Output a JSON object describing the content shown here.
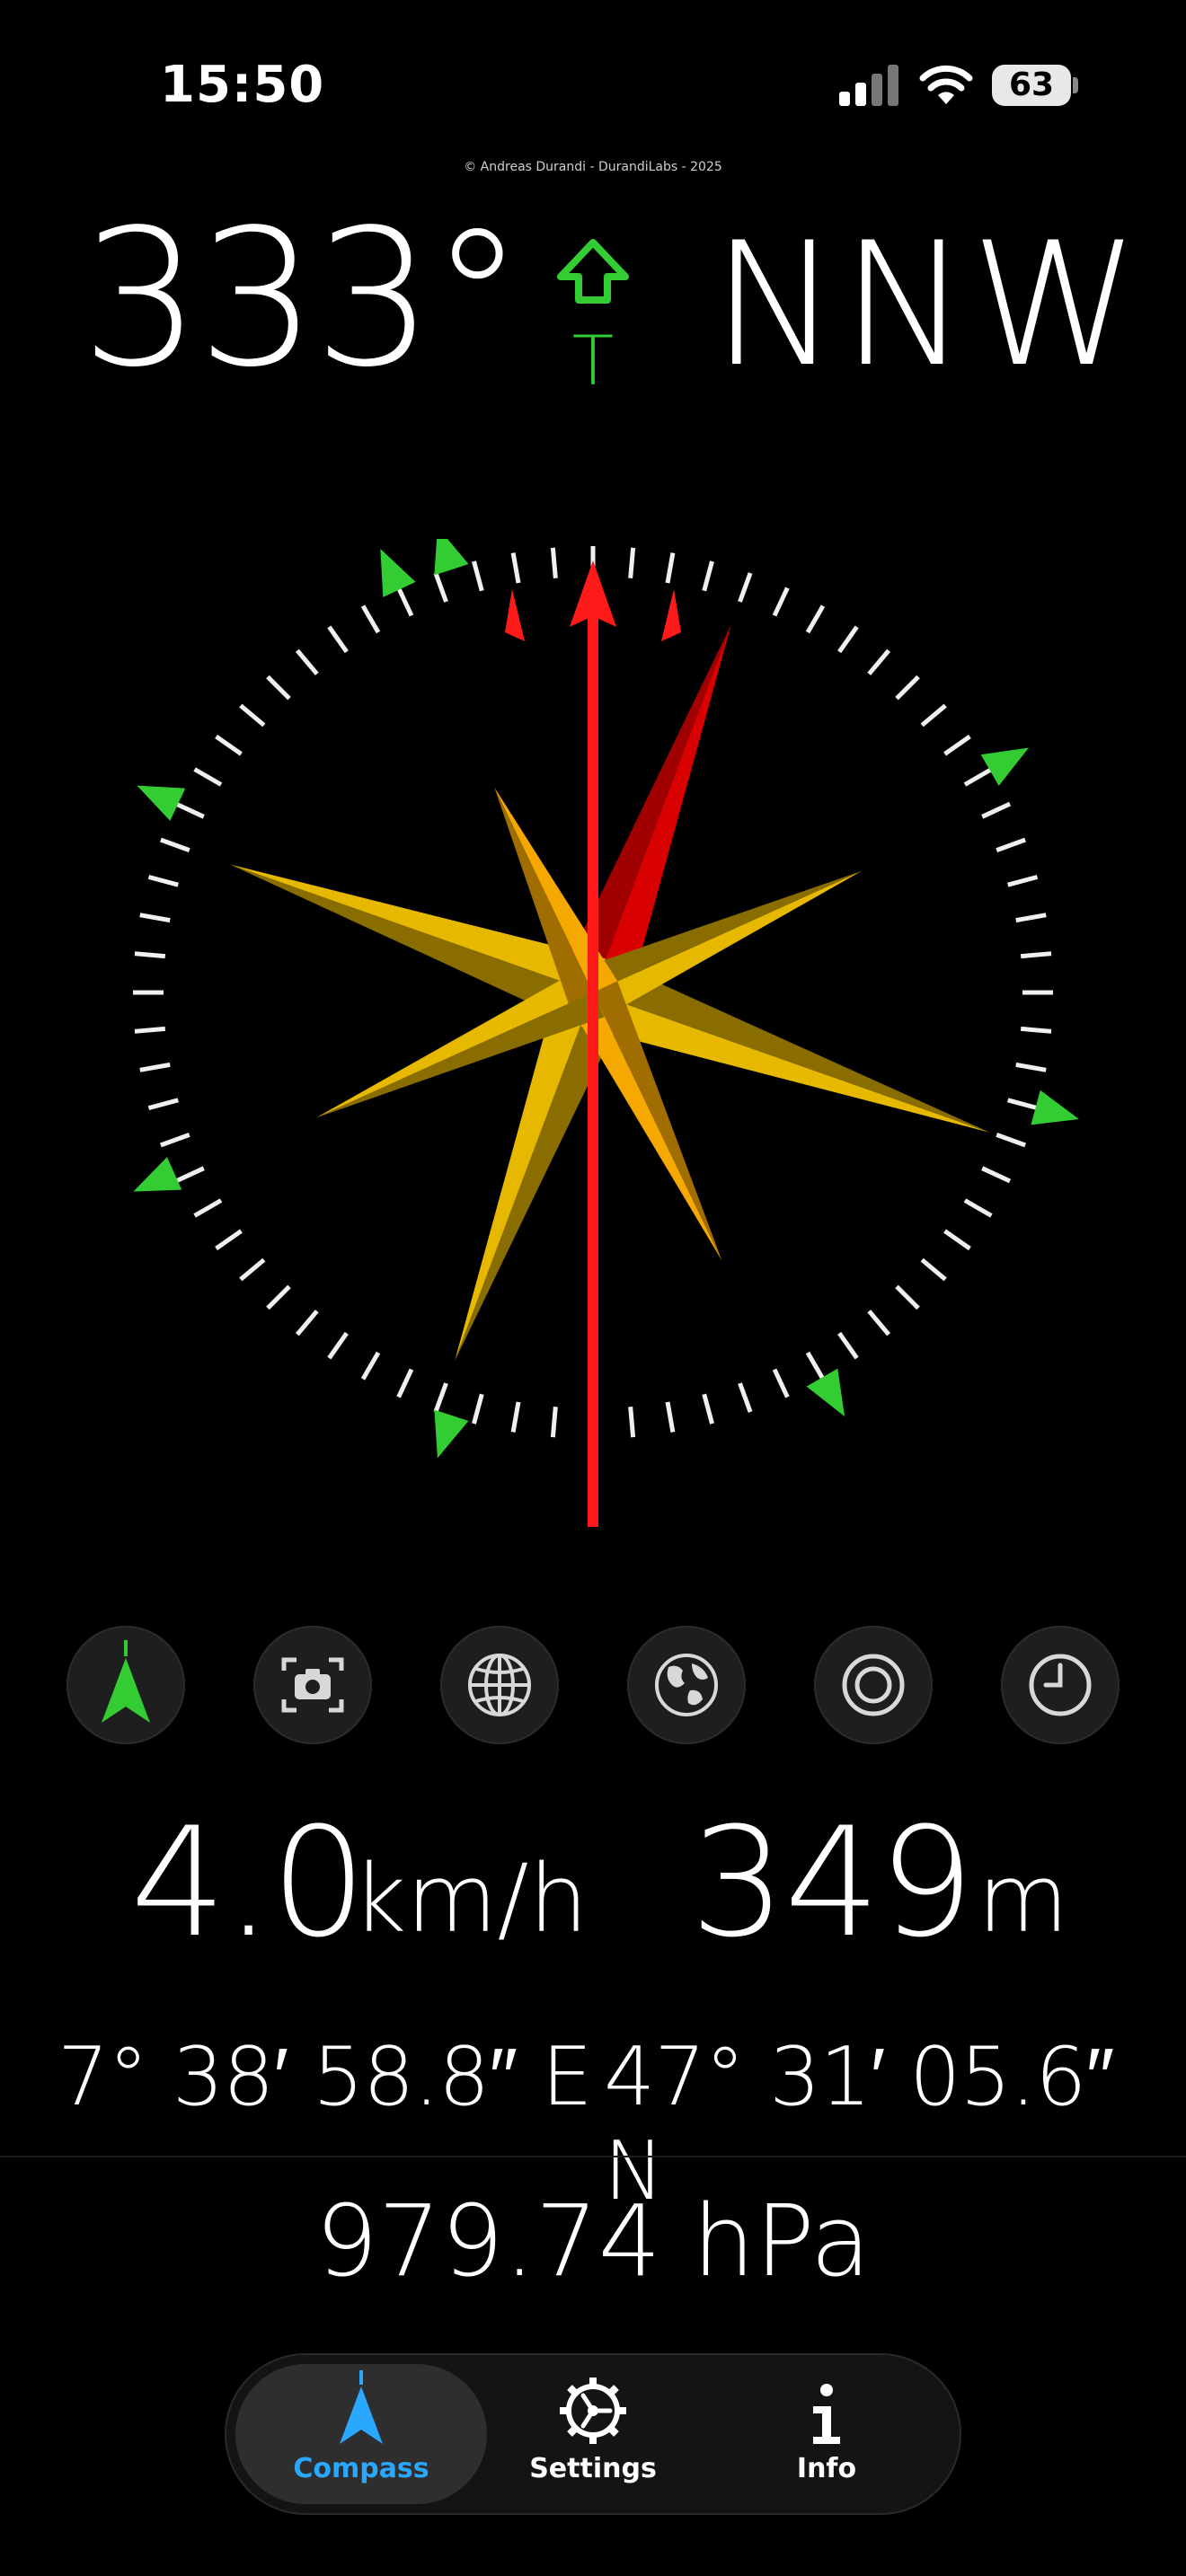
{
  "status_bar": {
    "time": "15:50",
    "battery": "63",
    "icons": [
      "cellular-signal-icon",
      "wifi-icon",
      "battery-icon"
    ]
  },
  "copyright": "© Andreas Durandi - DurandiLabs - 2025",
  "heading": {
    "degrees": "333°",
    "cardinal": "NNW",
    "true_north_indicator": "T"
  },
  "compass": {
    "heading_deg": 333,
    "star_colors": {
      "gold": "#e6b800",
      "dark_gold": "#8a6d00",
      "red": "#d80000"
    },
    "tick_color": "#f0f0f0",
    "marker_color": "#33cc33",
    "needle_color": "#ff1a1a"
  },
  "modes": [
    {
      "name": "navigation-icon",
      "active": true
    },
    {
      "name": "camera-icon",
      "active": false
    },
    {
      "name": "globe-icon",
      "active": false
    },
    {
      "name": "earth-icon",
      "active": false
    },
    {
      "name": "target-icon",
      "active": false
    },
    {
      "name": "clock-icon",
      "active": false
    }
  ],
  "readouts": {
    "speed_value": "4.0",
    "speed_unit": "km/h",
    "altitude_value": "349",
    "altitude_unit": "m",
    "longitude": "7° 38′ 58.8″ E",
    "latitude": "47° 31′ 05.6″ N",
    "pressure": "979.74 hPa"
  },
  "tabs": [
    {
      "label": "Compass",
      "icon": "compass-arrow-icon",
      "active": true
    },
    {
      "label": "Settings",
      "icon": "gear-icon",
      "active": false
    },
    {
      "label": "Info",
      "icon": "info-icon",
      "active": false
    }
  ],
  "colors": {
    "accent": "#2aa7ff",
    "green": "#33cc33"
  }
}
